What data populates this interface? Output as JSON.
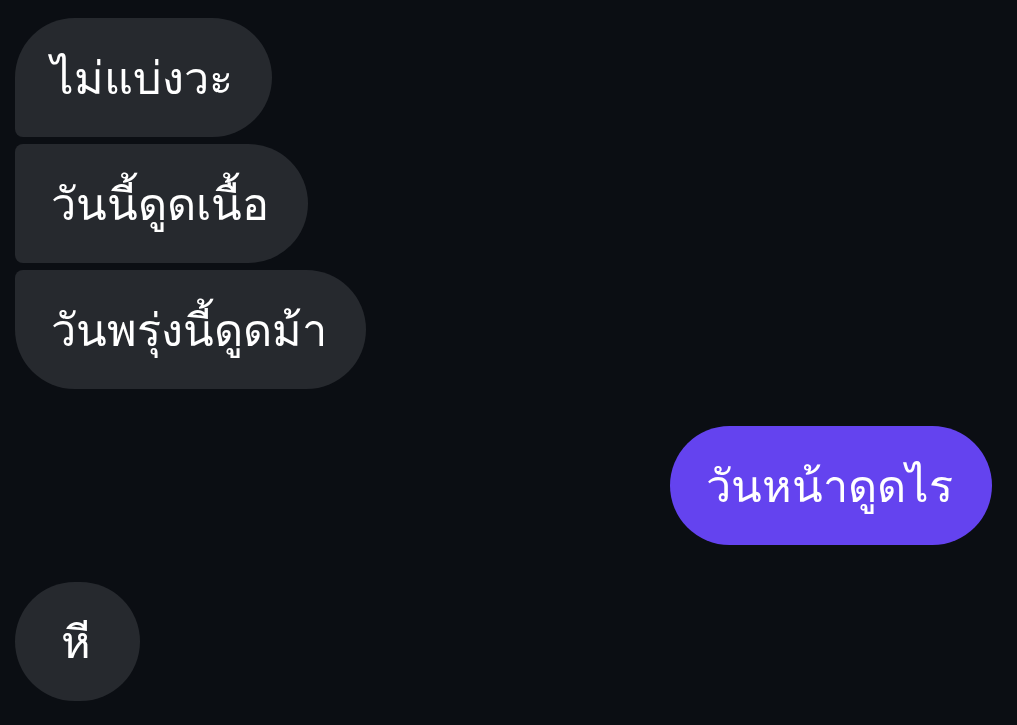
{
  "messages": [
    {
      "kind": "received",
      "text": "ไม่แบ่งวะ"
    },
    {
      "kind": "received",
      "text": "วันนี้ดูดเนื้อ"
    },
    {
      "kind": "received",
      "text": "วันพรุ่งนี้ดูดม้า"
    },
    {
      "kind": "sent",
      "text": "วันหน้าดูดไร"
    },
    {
      "kind": "received",
      "text": "หี"
    }
  ]
}
